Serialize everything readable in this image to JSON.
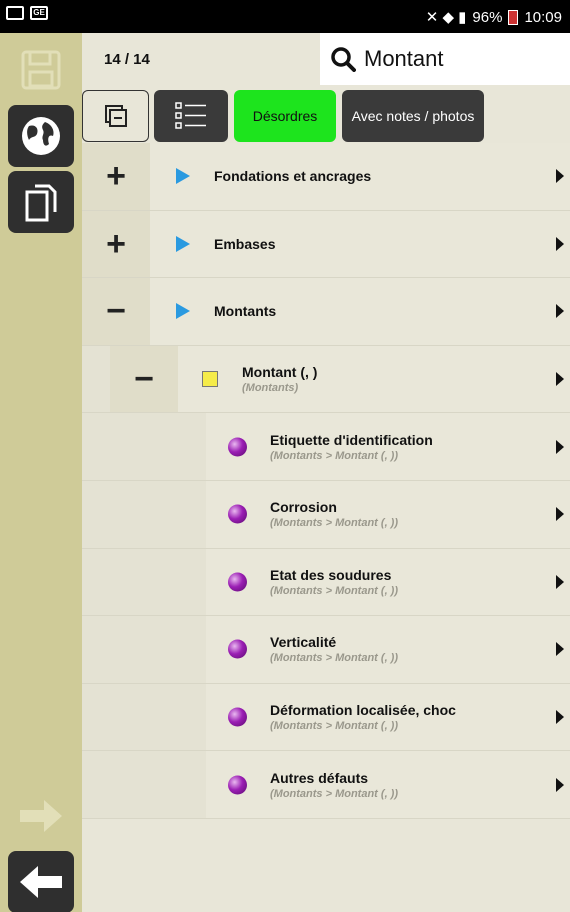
{
  "status_bar": {
    "battery": "96%",
    "time": "10:09",
    "left_icon_2": "GE"
  },
  "header": {
    "counter": "14 / 14",
    "search_value": "Montant"
  },
  "toolbar": {
    "desordres_label": "Désordres",
    "notes_label": "Avec notes / photos",
    "desordres_color": "#1de41d"
  },
  "rail": {
    "icons": [
      "save-icon",
      "globe-icon",
      "copy-icon",
      "arrow-right-icon",
      "arrow-left-icon"
    ]
  },
  "rows": [
    {
      "toggle": "+",
      "marker": "triangle",
      "title": "Fondations et ancrages",
      "subtitle": ""
    },
    {
      "toggle": "+",
      "marker": "triangle",
      "title": "Embases",
      "subtitle": ""
    },
    {
      "toggle": "−",
      "marker": "triangle",
      "title": "Montants",
      "subtitle": ""
    },
    {
      "toggle": "−",
      "marker": "square",
      "title": "Montant (, )",
      "subtitle": "(Montants)"
    },
    {
      "marker": "ball",
      "title": "Etiquette d'identification",
      "subtitle": "(Montants > Montant (, ))"
    },
    {
      "marker": "ball",
      "title": "Corrosion",
      "subtitle": "(Montants > Montant (, ))"
    },
    {
      "marker": "ball",
      "title": "Etat des soudures",
      "subtitle": "(Montants > Montant (, ))"
    },
    {
      "marker": "ball",
      "title": "Verticalité",
      "subtitle": "(Montants > Montant (, ))"
    },
    {
      "marker": "ball",
      "title": "Déformation localisée, choc",
      "subtitle": "(Montants > Montant (, ))"
    },
    {
      "marker": "ball",
      "title": "Autres défauts",
      "subtitle": "(Montants > Montant (, ))"
    }
  ]
}
